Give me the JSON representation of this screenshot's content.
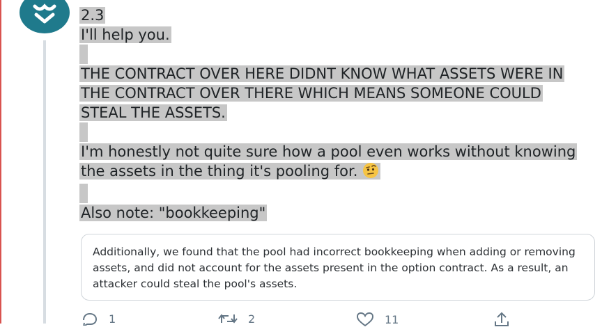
{
  "tweet": {
    "lines": [
      "2.3",
      "I'll help you.",
      "",
      "THE CONTRACT OVER HERE DIDNT KNOW WHAT ASSETS WERE IN",
      "THE CONTRACT OVER THERE WHICH MEANS SOMEONE COULD",
      "STEAL THE ASSETS.",
      "",
      "I'm honestly not quite sure how a pool even works without knowing",
      "the assets in the thing it's pooling for.",
      "",
      "Also note: \"bookkeeping\""
    ],
    "emoji": "face-with-raised-eyebrow-emoji"
  },
  "quote": {
    "text": "Additionally, we found that the pool had incorrect bookkeeping when adding or removing assets, and did not account for the assets present in the option contract. As a result, an attacker could steal the pool's assets."
  },
  "actions": {
    "reply_count": "1",
    "retweet_count": "2",
    "like_count": "11"
  },
  "colors": {
    "avatar": "#1f7a8c",
    "highlight": "#c7c7c7",
    "icon": "#657786"
  }
}
